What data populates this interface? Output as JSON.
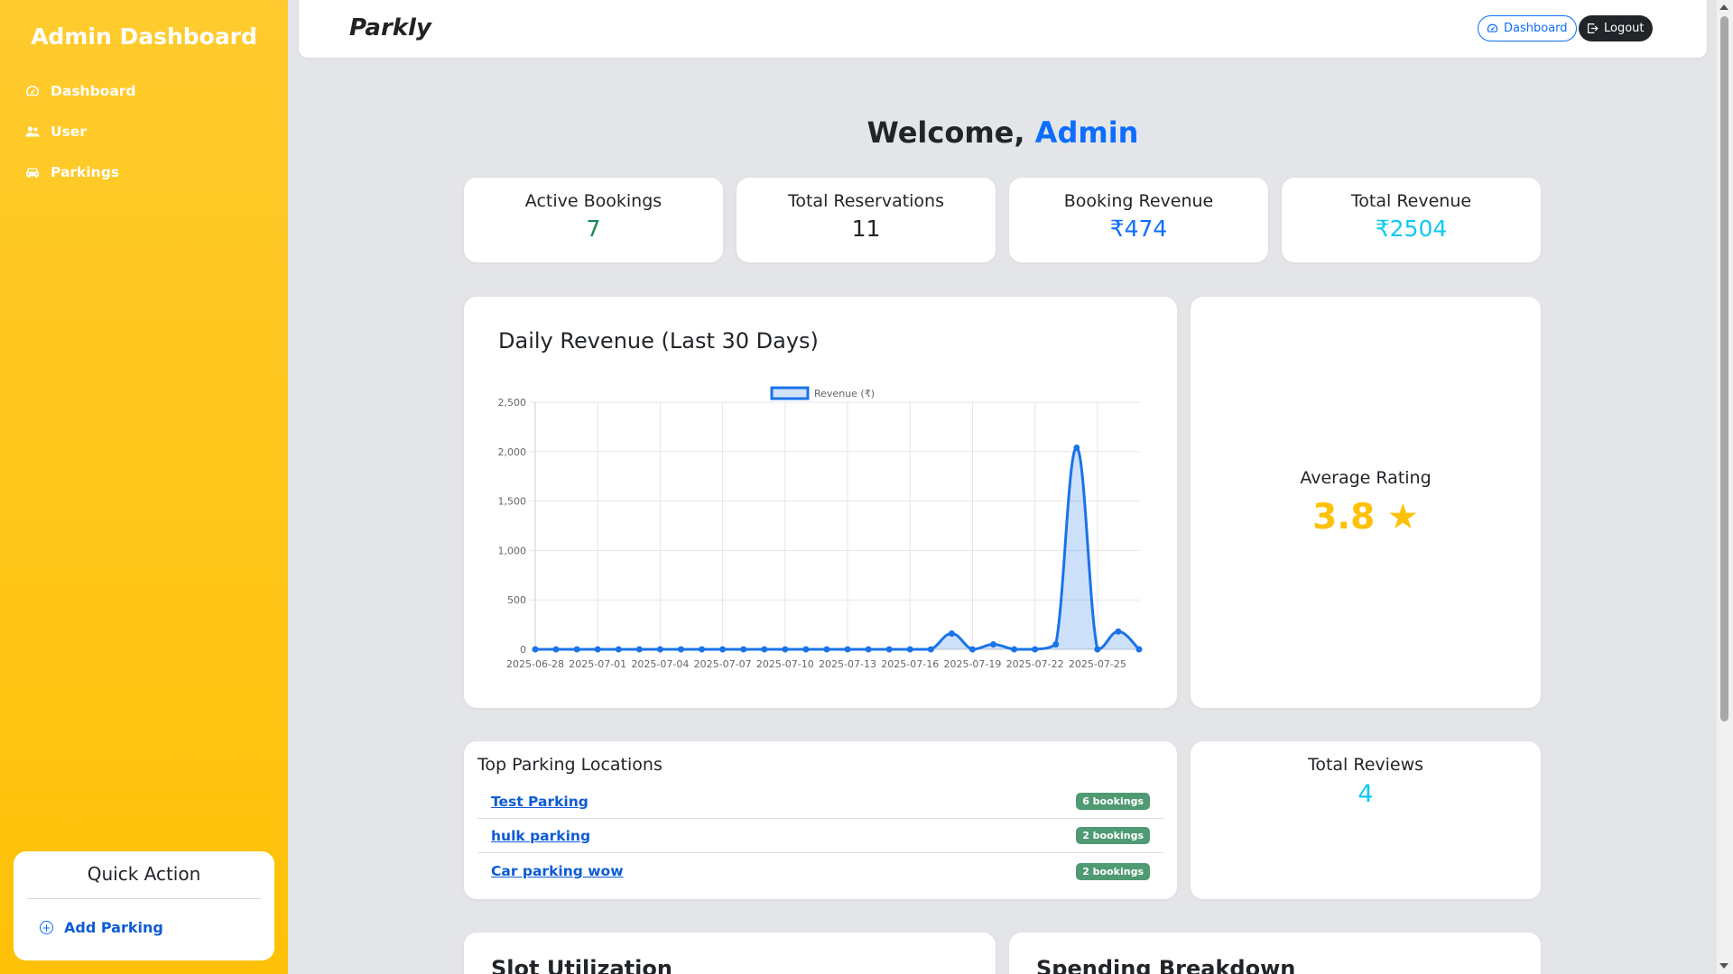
{
  "sidebar": {
    "title": "Admin Dashboard",
    "items": [
      {
        "label": "Dashboard",
        "icon": "gauge-icon"
      },
      {
        "label": "User",
        "icon": "users-icon"
      },
      {
        "label": "Parkings",
        "icon": "car-icon"
      }
    ],
    "quick_action": {
      "title": "Quick Action",
      "item": "Add Parking"
    }
  },
  "topbar": {
    "brand": "Parkly",
    "dashboard_button": "Dashboard",
    "logout_button": "Logout"
  },
  "welcome": {
    "prefix": "Welcome, ",
    "name": "Admin"
  },
  "stats": [
    {
      "label": "Active Bookings",
      "value": "7",
      "color": "#198754"
    },
    {
      "label": "Total Reservations",
      "value": "11",
      "color": "#212529"
    },
    {
      "label": "Booking Revenue",
      "value": "₹474",
      "color": "#0d6efd"
    },
    {
      "label": "Total Revenue",
      "value": "₹2504",
      "color": "#0dcaf0"
    }
  ],
  "chart_title": "Daily Revenue (Last 30 Days)",
  "chart_data": {
    "type": "area",
    "series": [
      {
        "name": "Revenue (₹)",
        "color": "#1a73e8",
        "values": [
          0,
          0,
          0,
          0,
          0,
          0,
          0,
          0,
          0,
          0,
          0,
          0,
          0,
          0,
          0,
          0,
          0,
          0,
          0,
          0,
          160,
          0,
          50,
          0,
          0,
          50,
          2040,
          0,
          180,
          0
        ]
      }
    ],
    "x": [
      "2025-06-28",
      "2025-06-29",
      "2025-06-30",
      "2025-07-01",
      "2025-07-02",
      "2025-07-03",
      "2025-07-04",
      "2025-07-05",
      "2025-07-06",
      "2025-07-07",
      "2025-07-08",
      "2025-07-09",
      "2025-07-10",
      "2025-07-11",
      "2025-07-12",
      "2025-07-13",
      "2025-07-14",
      "2025-07-15",
      "2025-07-16",
      "2025-07-17",
      "2025-07-18",
      "2025-07-19",
      "2025-07-20",
      "2025-07-21",
      "2025-07-22",
      "2025-07-23",
      "2025-07-24",
      "2025-07-25",
      "2025-07-26",
      "2025-07-27"
    ],
    "x_tick_labels": [
      "2025-06-28",
      "2025-07-01",
      "2025-07-04",
      "2025-07-07",
      "2025-07-10",
      "2025-07-13",
      "2025-07-16",
      "2025-07-19",
      "2025-07-22",
      "2025-07-25"
    ],
    "y_ticks": [
      "0",
      "500",
      "1,000",
      "1,500",
      "2,000",
      "2,500"
    ],
    "ylim": [
      0,
      2500
    ],
    "legend": "top-center",
    "grid": true
  },
  "rating": {
    "label": "Average Rating",
    "value": "3.8 ★"
  },
  "top_locations": {
    "title": "Top Parking Locations",
    "items": [
      {
        "name": "Test Parking",
        "badge": "6 bookings"
      },
      {
        "name": "hulk parking",
        "badge": "2 bookings"
      },
      {
        "name": "Car parking wow",
        "badge": "2 bookings"
      }
    ]
  },
  "reviews": {
    "label": "Total Reviews",
    "value": "4"
  },
  "bottom_cards": [
    {
      "title": "Slot Utilization"
    },
    {
      "title": "Spending Breakdown"
    }
  ]
}
